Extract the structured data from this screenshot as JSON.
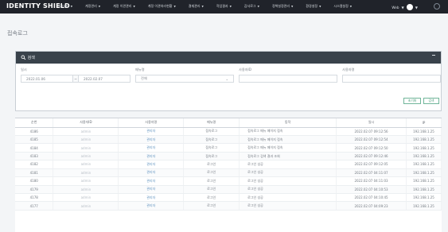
{
  "app": {
    "brand": "IDENTITY SHIELD",
    "user_label": "Web",
    "help_icon": "question-circle-icon",
    "avatar_icon": "user-circle-icon"
  },
  "nav": {
    "items": [
      "대시보드",
      "계정관리",
      "계정 이관관리",
      "계정 이관처리현황",
      "결재관리",
      "작업결과",
      "감사로그",
      "정책설정관리",
      "환경설정",
      "시스템설정"
    ]
  },
  "page": {
    "title": "접속로그"
  },
  "search": {
    "header": "검색",
    "date_label": "일시",
    "start_date": "2022.01.06",
    "date_separator": "~",
    "end_date": "2022.02.07",
    "menu_label": "메뉴명",
    "menu_value": "전체",
    "user_id_label": "사용자ID",
    "user_id_value": "",
    "user_name_label": "사용자명",
    "user_name_value": "",
    "reset_label": "초기화",
    "search_label": "검색"
  },
  "table": {
    "headers": [
      "순번",
      "사용자ID",
      "사용자명",
      "메뉴명",
      "동작",
      "일시",
      "IP"
    ],
    "rows": [
      [
        "4186",
        "admin",
        "관리자",
        "접속로그",
        "접속로그 메뉴 페이지 접속",
        "2022.02.07 09:12:56",
        "192.168.1.25"
      ],
      [
        "4185",
        "admin",
        "관리자",
        "접속로그",
        "접속로그 메뉴 페이지 접속",
        "2022.02.07 09:12:54",
        "192.168.1.25"
      ],
      [
        "4184",
        "admin",
        "관리자",
        "접속로그",
        "접속로그 메뉴 페이지 접속",
        "2022.02.07 09:12:50",
        "192.168.1.25"
      ],
      [
        "4183",
        "admin",
        "관리자",
        "접속로그",
        "접속로그 검색 결과 조회",
        "2022.02.07 09:12:46",
        "192.168.1.25"
      ],
      [
        "4182",
        "admin",
        "관리자",
        "로그인",
        "로그인 성공",
        "2022.02.07 09:12:05",
        "192.168.1.25"
      ],
      [
        "4181",
        "admin",
        "관리자",
        "로그인",
        "로그인 성공",
        "2022.02.07 04:11:07",
        "192.168.1.25"
      ],
      [
        "4180",
        "admin",
        "관리자",
        "로그인",
        "로그인 성공",
        "2022.02.07 04:11:03",
        "192.168.1.25"
      ],
      [
        "4179",
        "admin",
        "관리자",
        "로그인",
        "로그인 성공",
        "2022.02.07 04:10:53",
        "192.168.1.25"
      ],
      [
        "4178",
        "admin",
        "관리자",
        "로그인",
        "로그인 성공",
        "2022.02.07 04:10:45",
        "192.168.1.25"
      ],
      [
        "4177",
        "admin",
        "관리자",
        "로그인",
        "로그인 성공",
        "2022.02.07 04:09:23",
        "192.168.1.25"
      ]
    ]
  }
}
